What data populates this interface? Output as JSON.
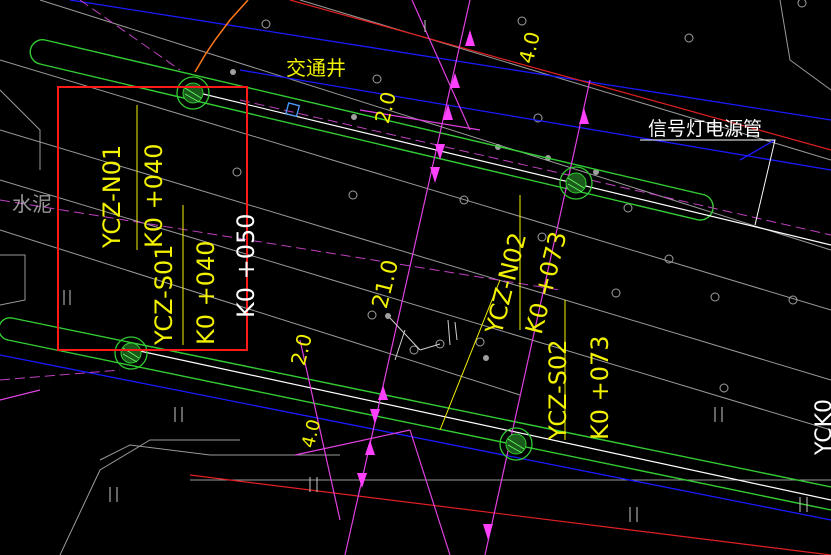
{
  "labels": {
    "traffic_well": "交通井",
    "signal_conduit": "信号灯电源管",
    "cement": "水泥",
    "n01_code": "YCZ-N01",
    "n01_station": "K0 +040",
    "s01_code": "YCZ-S01",
    "s01_station": "K0 +040",
    "k050": "K0 +050",
    "n02_code": "YCZ-N02",
    "n02_station": "K0 +073",
    "s02_code": "YCZ-S02",
    "s02_station": "K0 +073",
    "dim_40_top": "4.0",
    "dim_20_top": "2.0",
    "dim_210": "21.0",
    "dim_20_left": "2.0",
    "dim_40_bottom": "4.0",
    "edge_text": "YCK0"
  },
  "colors": {
    "background": "#000000",
    "annotation_text": "#f2f200",
    "selection_box": "#ff1a1a",
    "pipe_outline": "#33cc33",
    "dimension": "#e040e0",
    "road_edge_blue": "#1a1aff",
    "red_line": "#e02020",
    "orange_line": "#ff7a1a"
  }
}
